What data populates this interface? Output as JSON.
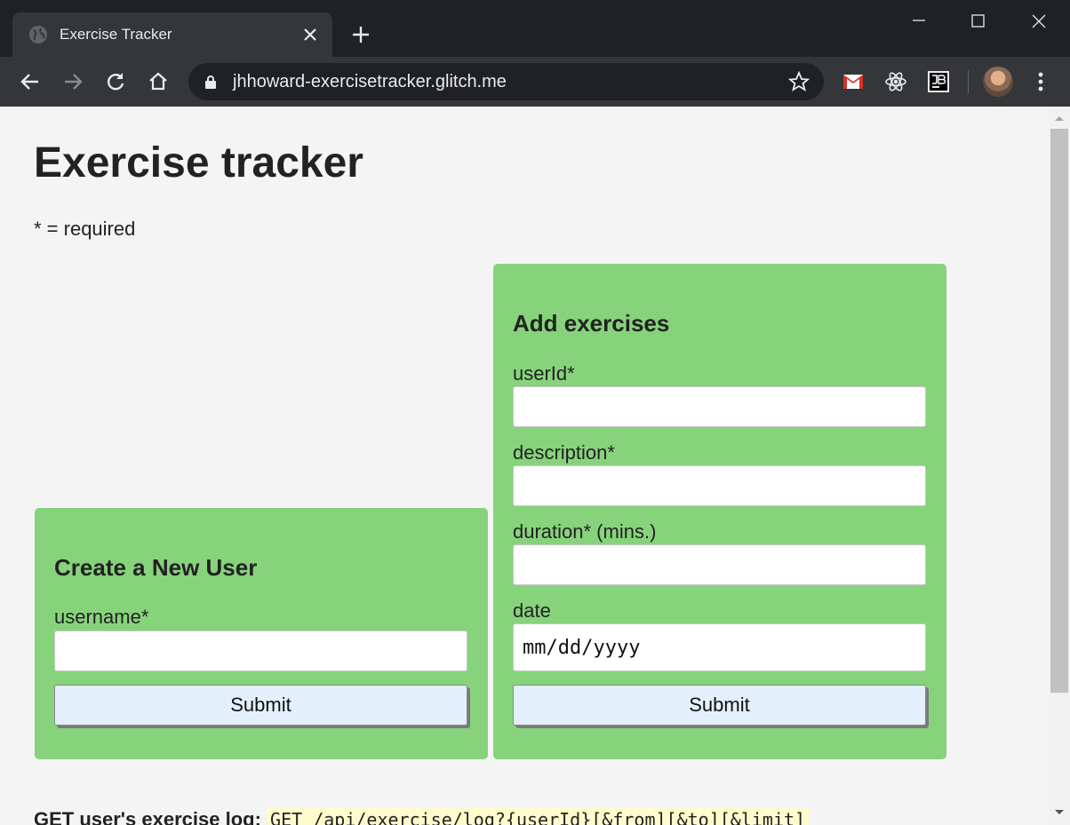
{
  "browser": {
    "tab_title": "Exercise Tracker",
    "url": "jhhoward-exercisetracker.glitch.me",
    "extensions": [
      "gmail-icon",
      "react-devtools-icon",
      "jetbrains-icon"
    ]
  },
  "page": {
    "title": "Exercise tracker",
    "required_note": "* = required"
  },
  "create_user": {
    "heading": "Create a New User",
    "username_label": "username*",
    "username_value": "",
    "submit_label": "Submit"
  },
  "add_exercises": {
    "heading": "Add exercises",
    "userid_label": "userId*",
    "userid_value": "",
    "description_label": "description*",
    "description_value": "",
    "duration_label": "duration* (mins.)",
    "duration_value": "",
    "date_label": "date",
    "date_placeholder": "mm/dd/yyyy",
    "submit_label": "Submit"
  },
  "log": {
    "label": "GET user's exercise log:",
    "endpoint": "GET /api/exercise/log?{userId}[&from][&to][&limit]"
  },
  "colors": {
    "card_bg": "#87d37c",
    "page_bg": "#f4f4f4",
    "button_bg": "#e3f0fb",
    "chrome_dark": "#202124",
    "chrome_toolbar": "#35363a"
  }
}
